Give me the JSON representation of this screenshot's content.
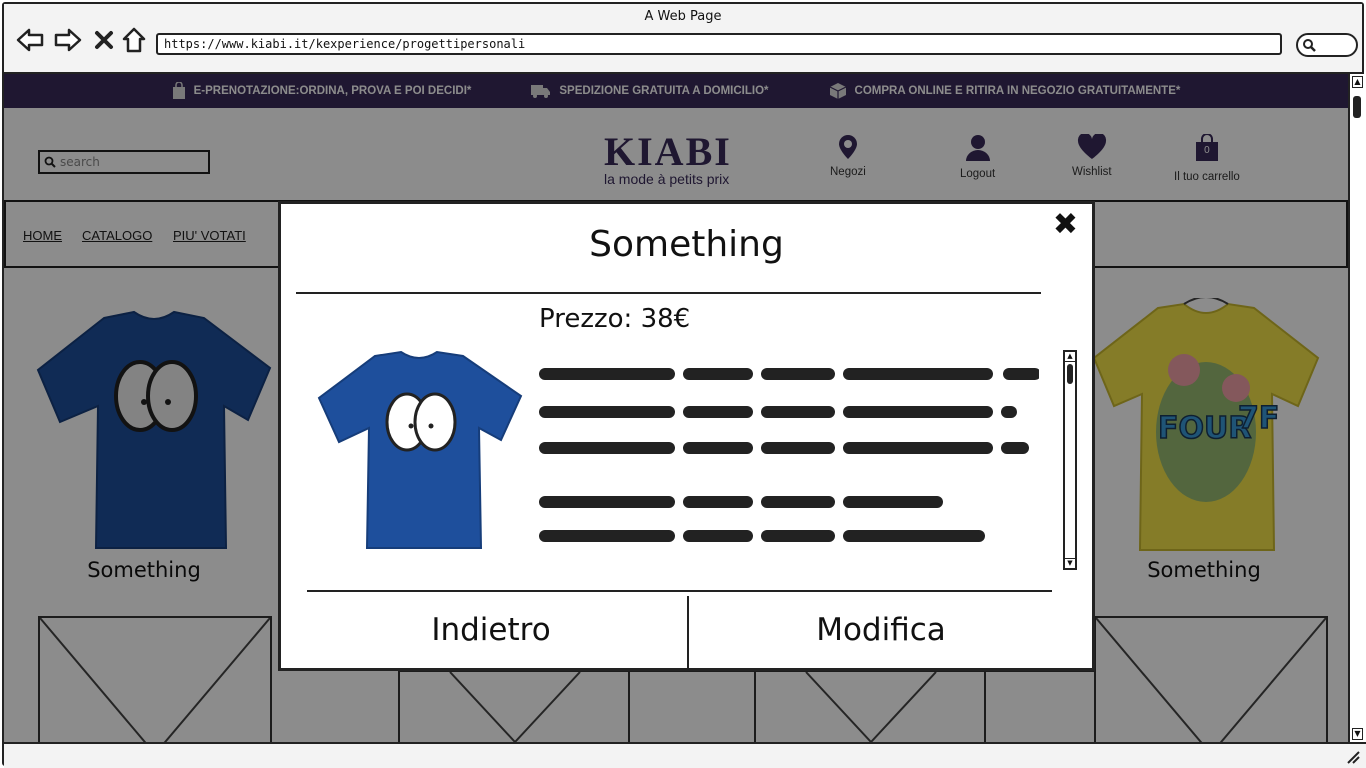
{
  "window": {
    "title": "A Web Page",
    "url": "https://www.kiabi.it/kexperience/progettipersonali"
  },
  "promo": [
    {
      "icon": "shopping-bag-icon",
      "text": "E-PRENOTAZIONE:ORDINA, PROVA E POI DECIDI*"
    },
    {
      "icon": "truck-icon",
      "text": "SPEDIZIONE GRATUITA A DOMICILIO*"
    },
    {
      "icon": "package-icon",
      "text": "COMPRA ONLINE E RITIRA IN NEGOZIO GRATUITAMENTE*"
    }
  ],
  "header": {
    "search_placeholder": "search",
    "logo": {
      "main": "KIABI",
      "sub": "la mode à petits prix"
    },
    "icons": [
      {
        "name": "location-pin-icon",
        "label": "Negozi"
      },
      {
        "name": "user-icon",
        "label": "Logout"
      },
      {
        "name": "heart-icon",
        "label": "Wishlist"
      },
      {
        "name": "cart-icon",
        "label": "Il tuo carrello",
        "count": "0"
      }
    ]
  },
  "menu": [
    "HOME",
    "CATALOGO",
    "PIU' VOTATI"
  ],
  "products": [
    {
      "title": "Something",
      "color": "#1e4f9c"
    },
    {
      "title": "Something",
      "color": "#f2e24a"
    }
  ],
  "modal": {
    "title": "Something",
    "price": "Prezzo: 38€",
    "back_label": "Indietro",
    "edit_label": "Modifica",
    "shirt_color": "#1e4f9c"
  },
  "colors": {
    "brand": "#3a2a5a"
  }
}
